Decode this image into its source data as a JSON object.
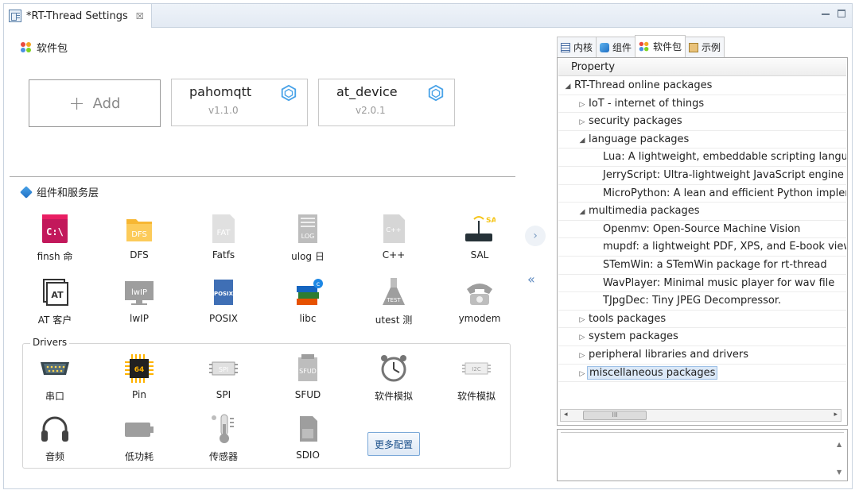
{
  "tab": {
    "title": "*RT-Thread Settings",
    "close": "☒"
  },
  "packages_section": {
    "title": "软件包",
    "add_label": "Add",
    "packages": [
      {
        "name": "pahomqtt",
        "version": "v1.1.0"
      },
      {
        "name": "at_device",
        "version": "v2.0.1"
      }
    ]
  },
  "components_section": {
    "title": "组件和服务层",
    "items": [
      {
        "label": "finsh 命",
        "icon": "terminal-icon"
      },
      {
        "label": "DFS",
        "icon": "folder-icon"
      },
      {
        "label": "Fatfs",
        "icon": "file-fat-icon"
      },
      {
        "label": "ulog 日",
        "icon": "log-icon"
      },
      {
        "label": "C++",
        "icon": "cpp-file-icon"
      },
      {
        "label": "SAL",
        "icon": "router-icon"
      },
      {
        "label": "AT 客户",
        "icon": "at-icon"
      },
      {
        "label": "lwIP",
        "icon": "monitor-icon"
      },
      {
        "label": "POSIX",
        "icon": "book-icon"
      },
      {
        "label": "libc",
        "icon": "books-icon"
      },
      {
        "label": "utest 测",
        "icon": "flask-icon"
      },
      {
        "label": "ymodem",
        "icon": "telephone-icon"
      }
    ]
  },
  "drivers_section": {
    "title": "Drivers",
    "items": [
      {
        "label": "串口",
        "icon": "serial-port-icon"
      },
      {
        "label": "Pin",
        "icon": "chip-icon"
      },
      {
        "label": "SPI",
        "icon": "spi-icon"
      },
      {
        "label": "SFUD",
        "icon": "flash-icon"
      },
      {
        "label": "软件模拟",
        "icon": "clock-icon"
      },
      {
        "label": "软件模拟",
        "icon": "i2c-icon"
      },
      {
        "label": "音频",
        "icon": "headphones-icon"
      },
      {
        "label": "低功耗",
        "icon": "battery-icon"
      },
      {
        "label": "传感器",
        "icon": "thermometer-icon"
      },
      {
        "label": "SDIO",
        "icon": "sd-card-icon"
      }
    ],
    "more_button": "更多配置"
  },
  "nav": {
    "next": "›",
    "collapse": "«"
  },
  "right_tabs": [
    {
      "label": "内核",
      "icon": "kernel-icon"
    },
    {
      "label": "组件",
      "icon": "cube-icon"
    },
    {
      "label": "软件包",
      "icon": "packages-icon"
    },
    {
      "label": "示例",
      "icon": "clipboard-icon"
    }
  ],
  "tree": {
    "header": "Property",
    "rows": [
      {
        "text": "RT-Thread online packages",
        "level": 0,
        "toggle": "◢"
      },
      {
        "text": "IoT - internet of things",
        "level": 1,
        "toggle": "▷"
      },
      {
        "text": "security packages",
        "level": 1,
        "toggle": "▷"
      },
      {
        "text": "language packages",
        "level": 1,
        "toggle": "◢"
      },
      {
        "text": "Lua: A lightweight, embeddable scripting language",
        "level": 2,
        "toggle": ""
      },
      {
        "text": "JerryScript: Ultra-lightweight JavaScript engine",
        "level": 2,
        "toggle": ""
      },
      {
        "text": "MicroPython: A lean and efficient Python implementation",
        "level": 2,
        "toggle": ""
      },
      {
        "text": "multimedia packages",
        "level": 1,
        "toggle": "◢"
      },
      {
        "text": "Openmv: Open-Source Machine Vision",
        "level": 2,
        "toggle": ""
      },
      {
        "text": "mupdf: a lightweight PDF, XPS, and E-book viewer",
        "level": 2,
        "toggle": ""
      },
      {
        "text": "STemWin: a STemWin package for rt-thread",
        "level": 2,
        "toggle": ""
      },
      {
        "text": "WavPlayer: Minimal music player for wav file",
        "level": 2,
        "toggle": ""
      },
      {
        "text": "TJpgDec: Tiny JPEG Decompressor.",
        "level": 2,
        "toggle": ""
      },
      {
        "text": "tools packages",
        "level": 1,
        "toggle": "▷"
      },
      {
        "text": "system packages",
        "level": 1,
        "toggle": "▷"
      },
      {
        "text": "peripheral libraries and drivers",
        "level": 1,
        "toggle": "▷"
      },
      {
        "text": "miscellaneous packages",
        "level": 1,
        "toggle": "▷",
        "selected": true
      }
    ],
    "scroll_grip": "III",
    "scroll_left": "◂",
    "scroll_right": "▸"
  },
  "desc_scroll": {
    "up": "▲",
    "down": "▼"
  },
  "colors": {
    "accent": "#1f6fc4",
    "selection": "#dbe8f7"
  }
}
